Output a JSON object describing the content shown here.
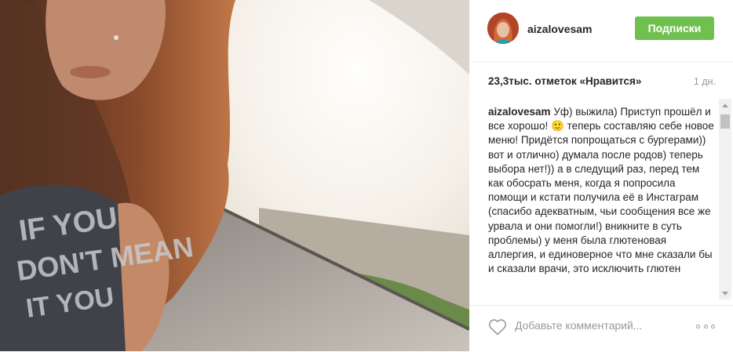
{
  "post": {
    "username": "aizalovesam",
    "follow_label": "Подписки",
    "likes_text": "23,3тыс. отметок «Нравится»",
    "time_ago": "1 дн.",
    "caption_author": "aizalovesam",
    "caption_text": "Уф) выжила) Приступ прошёл и все хорошо! 🙂 теперь составляю себе новое меню! Придётся попрощаться с бургерами)) вот и отлично) думала после родов) теперь выбора нет!)) а в следущий раз, перед тем как обосрать меня, когда я попросила помощи и кстати получила её в Инстаграм (спасибо адекватным, чьи сообщения все же урвала и они помогли!) вникните в суть проблемы) у меня была глютеновая аллергия, и единоверное что мне сказали бы и сказали врачи, это исключить глютен",
    "comment_placeholder": "Добавьте комментарий...",
    "photo_shirt_text": "IF YOU DON'T MEAN IT YOU"
  },
  "colors": {
    "follow_button": "#70c050",
    "muted_text": "#999999"
  },
  "icons": {
    "like": "heart-icon",
    "more": "more-options-icon"
  }
}
